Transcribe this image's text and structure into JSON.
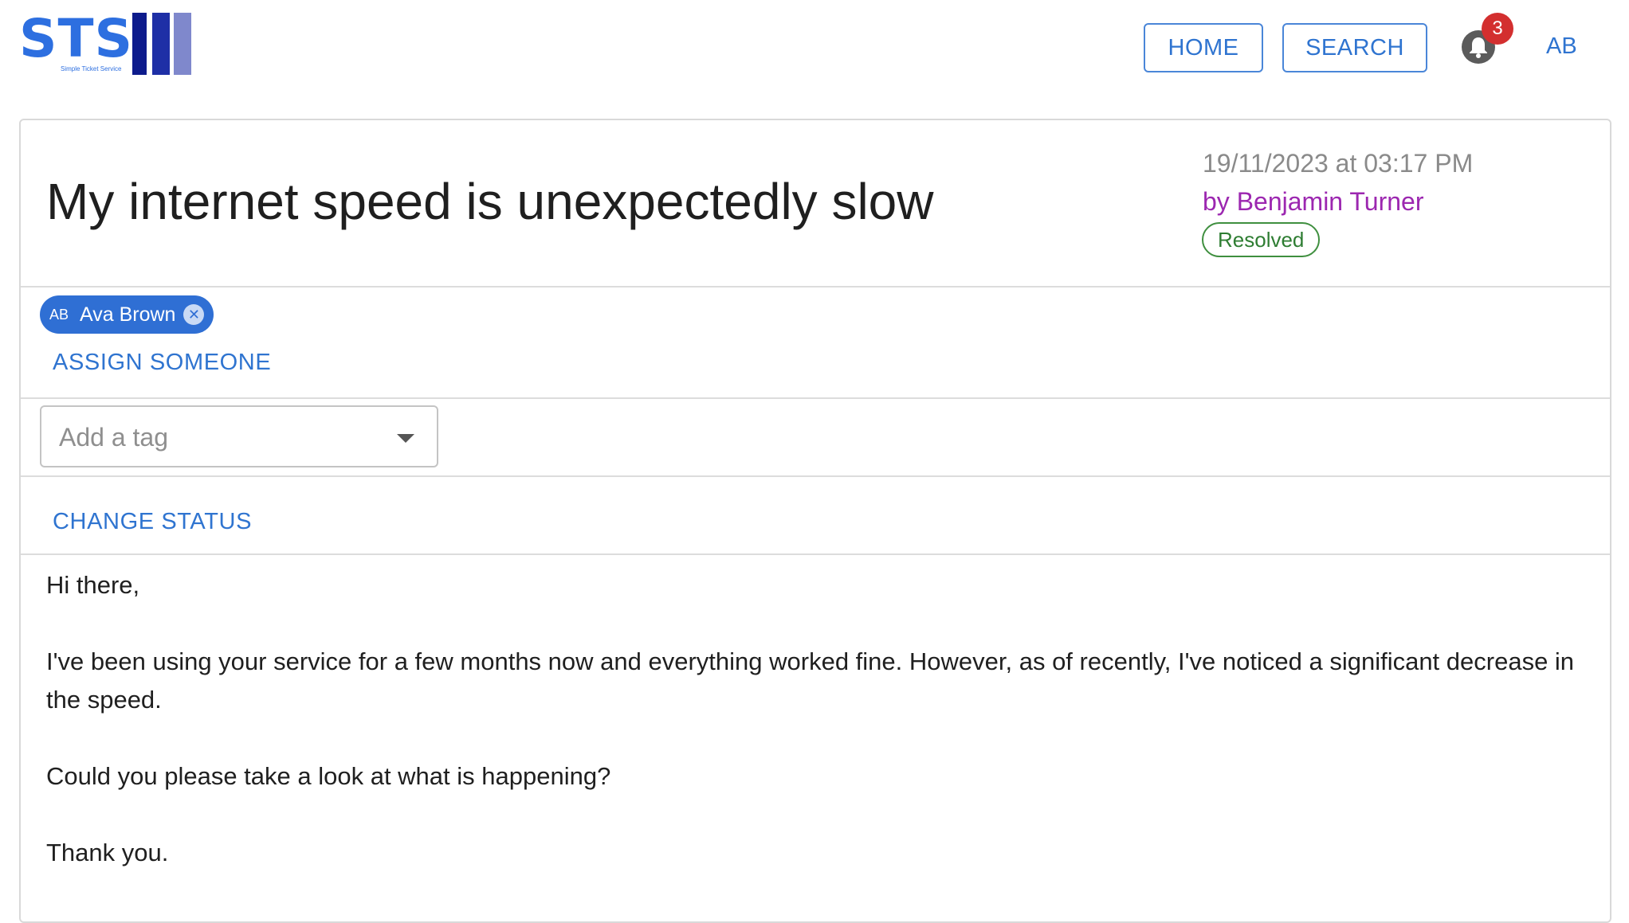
{
  "logo": {
    "text": "STS",
    "tagline": "Simple Ticket Service"
  },
  "nav": {
    "home_label": "HOME",
    "search_label": "SEARCH",
    "notification_count": "3",
    "user_initials": "AB",
    "icons": [
      "bell-icon"
    ]
  },
  "ticket": {
    "title": "My internet speed is unexpectedly slow",
    "date": "19/11/2023 at 03:17 PM",
    "author": "by Benjamin Turner",
    "status": "Resolved",
    "assignee": {
      "initials": "AB",
      "name": "Ava Brown"
    },
    "assign_label": "ASSIGN SOMEONE",
    "tag_placeholder": "Add a tag",
    "change_status_label": "CHANGE STATUS",
    "body": [
      "Hi there,",
      "I've been using your service for a few months now and everything worked fine. However, as of recently, I've noticed a significant decrease in the speed.",
      "Could you please take a look at what is happening?",
      "Thank you."
    ]
  },
  "colors": {
    "accent": "#2f74d0",
    "author": "#9c27b0",
    "status_resolved": "#2e7d32",
    "badge": "#d32f2f"
  }
}
